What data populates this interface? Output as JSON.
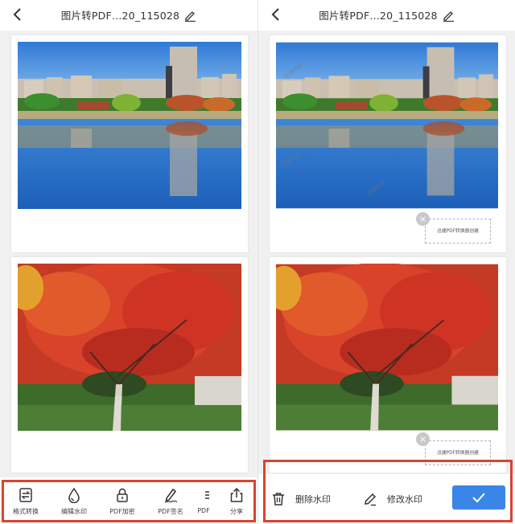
{
  "left": {
    "title": "图片转PDF…20_115028",
    "toolbar": [
      {
        "label": "格式转换",
        "icon": "format-convert-icon"
      },
      {
        "label": "编辑水印",
        "icon": "watermark-drop-icon"
      },
      {
        "label": "PDF加密",
        "icon": "lock-icon"
      },
      {
        "label": "PDF签名",
        "icon": "signature-pen-icon"
      },
      {
        "label": "PDF",
        "icon": "more-icon"
      },
      {
        "label": "分享",
        "icon": "share-icon"
      }
    ]
  },
  "right": {
    "title": "图片转PDF…20_115028",
    "watermark_box_text": "迅捷PDF转换器创建",
    "watermark_text": "迅捷PDF",
    "actions": {
      "delete_label": "删除水印",
      "edit_label": "修改水印"
    }
  },
  "colors": {
    "accent": "#3a85e8",
    "highlight_frame": "#d9432f"
  }
}
